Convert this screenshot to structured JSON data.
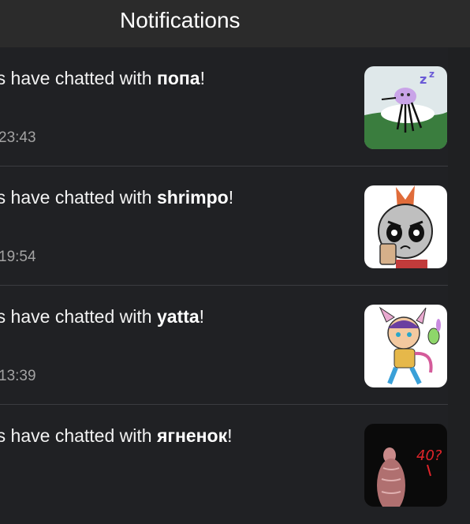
{
  "header": {
    "title": "Notifications"
  },
  "notifications": [
    {
      "prefix": "rs have chatted with ",
      "name": "попа",
      "suffix": "!",
      "time": "23:43",
      "thumbnail_icon": "purple-creature-image"
    },
    {
      "prefix": "rs have chatted with ",
      "name": "shrimpo",
      "suffix": "!",
      "time": "19:54",
      "thumbnail_icon": "shrimpo-character-image"
    },
    {
      "prefix": "rs have chatted with ",
      "name": "yatta",
      "suffix": "!",
      "time": "13:39",
      "thumbnail_icon": "yatta-character-image"
    },
    {
      "prefix": "rs have chatted with ",
      "name": "ягненок",
      "suffix": "!",
      "time": "",
      "thumbnail_icon": "lamb-character-image"
    }
  ],
  "thumbnail_texts": {
    "lamb_scribble": "40?"
  },
  "colors": {
    "background": "#202124",
    "header": "#2b2b2b",
    "divider": "#3b3c40",
    "timestamp": "#a3a3a3"
  }
}
